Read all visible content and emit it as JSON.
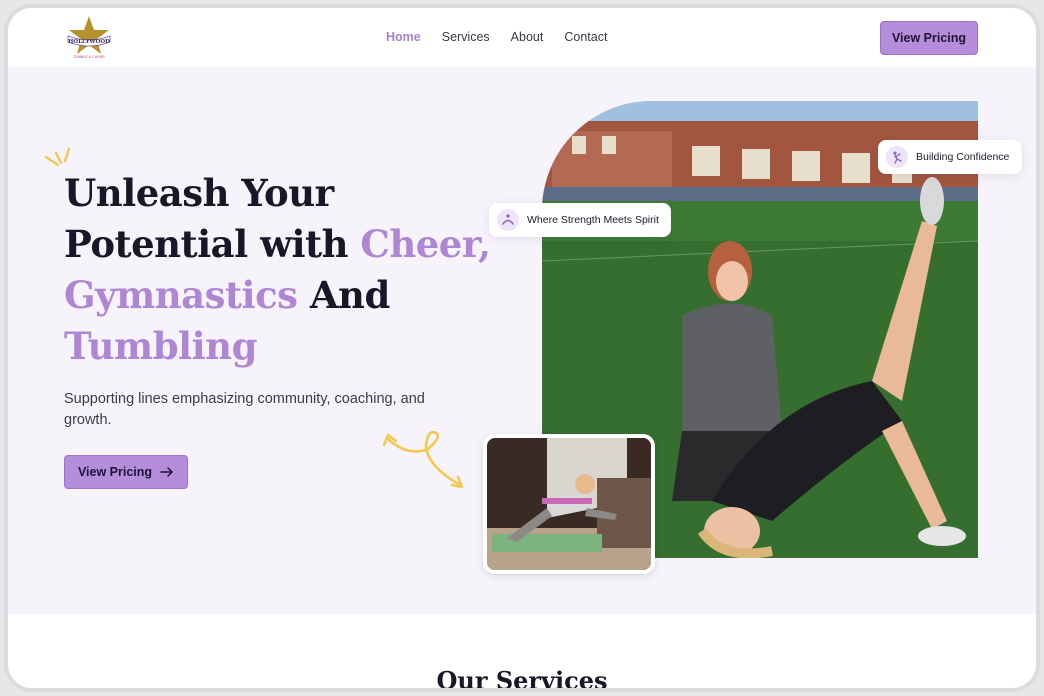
{
  "brand": {
    "logo_name": "HOLLYWOOD",
    "logo_tagline": "TUMBLE & CHEER",
    "accent_color": "#ae86d2",
    "button_color": "#b58ddb",
    "highlight_color": "#f6d86c"
  },
  "nav": {
    "items": [
      {
        "label": "Home",
        "active": true
      },
      {
        "label": "Services",
        "active": false
      },
      {
        "label": "About",
        "active": false
      },
      {
        "label": "Contact",
        "active": false
      }
    ],
    "cta_label": "View Pricing"
  },
  "hero": {
    "headline": {
      "line1": "Unleash Your",
      "line2a": "Potential with ",
      "line2b": "Cheer,",
      "line3a": "Gymnastics",
      "line3b": " And",
      "line4": "Tumbling"
    },
    "subtext": "Supporting lines emphasizing community, coaching, and growth.",
    "cta_label": "View Pricing",
    "badges": {
      "strength": "Where Strength Meets Spirit",
      "confidence": "Building Confidence"
    }
  },
  "services": {
    "title": "Our Services"
  }
}
